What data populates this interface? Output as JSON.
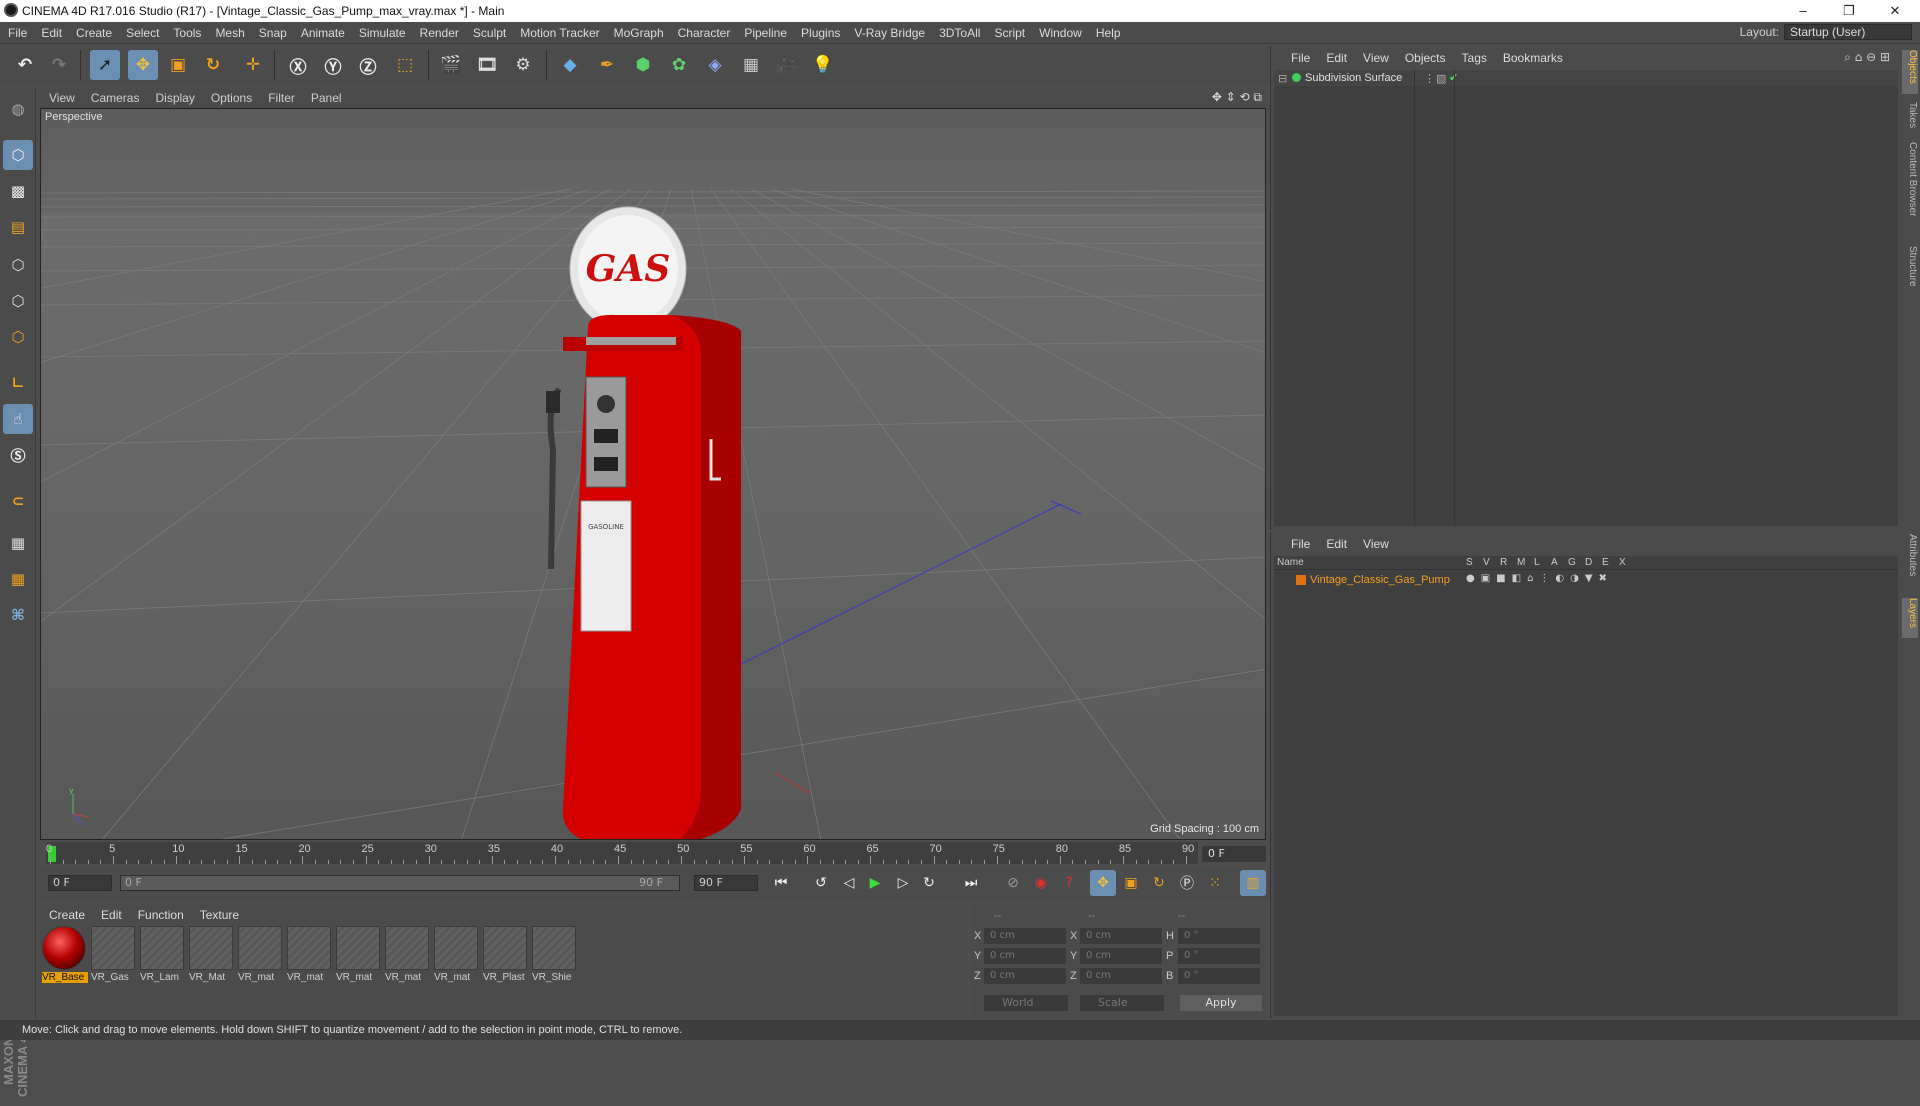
{
  "window": {
    "title": "CINEMA 4D R17.016 Studio (R17) - [Vintage_Classic_Gas_Pump_max_vray.max *] - Main",
    "controls": [
      "–",
      "❐",
      "✕"
    ]
  },
  "menubar": [
    "File",
    "Edit",
    "Create",
    "Select",
    "Tools",
    "Mesh",
    "Snap",
    "Animate",
    "Simulate",
    "Render",
    "Sculpt",
    "Motion Tracker",
    "MoGraph",
    "Character",
    "Pipeline",
    "Plugins",
    "V-Ray Bridge",
    "3DToAll",
    "Script",
    "Window",
    "Help"
  ],
  "layout": {
    "label": "Layout:",
    "value": "Startup (User)"
  },
  "viewport": {
    "menu": [
      "View",
      "Cameras",
      "Display",
      "Options",
      "Filter",
      "Panel"
    ],
    "label": "Perspective",
    "grid_spacing": "Grid Spacing : 100 cm",
    "pump_sign": "GAS",
    "pump_label": "GASOLINE"
  },
  "timeline": {
    "ticks": [
      "0",
      "5",
      "10",
      "15",
      "20",
      "25",
      "30",
      "35",
      "40",
      "45",
      "50",
      "55",
      "60",
      "65",
      "70",
      "75",
      "80",
      "85",
      "90"
    ],
    "current_frame": "0 F",
    "start_field": "0 F",
    "range_start": "0 F",
    "range_end": "90 F",
    "end_field": "90 F"
  },
  "material_manager": {
    "menu": [
      "Create",
      "Edit",
      "Function",
      "Texture"
    ],
    "materials": [
      "VR_Base",
      "VR_Gas",
      "VR_Lam",
      "VR_Mat",
      "VR_mat",
      "VR_mat",
      "VR_mat",
      "VR_mat",
      "VR_mat",
      "VR_Plast",
      "VR_Shie"
    ]
  },
  "coordinates": {
    "headers": [
      "--",
      "--",
      "--"
    ],
    "rows": [
      {
        "a": "X",
        "av": "0 cm",
        "b": "X",
        "bv": "0 cm",
        "c": "H",
        "cv": "0 °"
      },
      {
        "a": "Y",
        "av": "0 cm",
        "b": "Y",
        "bv": "0 cm",
        "c": "P",
        "cv": "0 °"
      },
      {
        "a": "Z",
        "av": "0 cm",
        "b": "Z",
        "bv": "0 cm",
        "c": "B",
        "cv": "0 °"
      }
    ],
    "space": "World",
    "mode": "Scale",
    "apply": "Apply"
  },
  "status": "Move: Click and drag to move elements. Hold down SHIFT to quantize movement / add to the selection in point mode, CTRL to remove.",
  "objects_panel": {
    "menu": [
      "File",
      "Edit",
      "View",
      "Objects",
      "Tags",
      "Bookmarks"
    ],
    "items": [
      "Subdivision Surface"
    ]
  },
  "layers_panel": {
    "menu": [
      "File",
      "Edit",
      "View"
    ],
    "columns": [
      "Name",
      "S",
      "V",
      "R",
      "M",
      "L",
      "A",
      "G",
      "D",
      "E",
      "X"
    ],
    "items": [
      "Vintage_Classic_Gas_Pump"
    ]
  },
  "side_tabs": [
    "Objects",
    "Takes",
    "Content Browser",
    "Structure",
    "Attributes",
    "Layers"
  ],
  "colors": {
    "accent": "#6b8fb3",
    "selection": "#e8a000",
    "pump_red": "#d90000"
  }
}
